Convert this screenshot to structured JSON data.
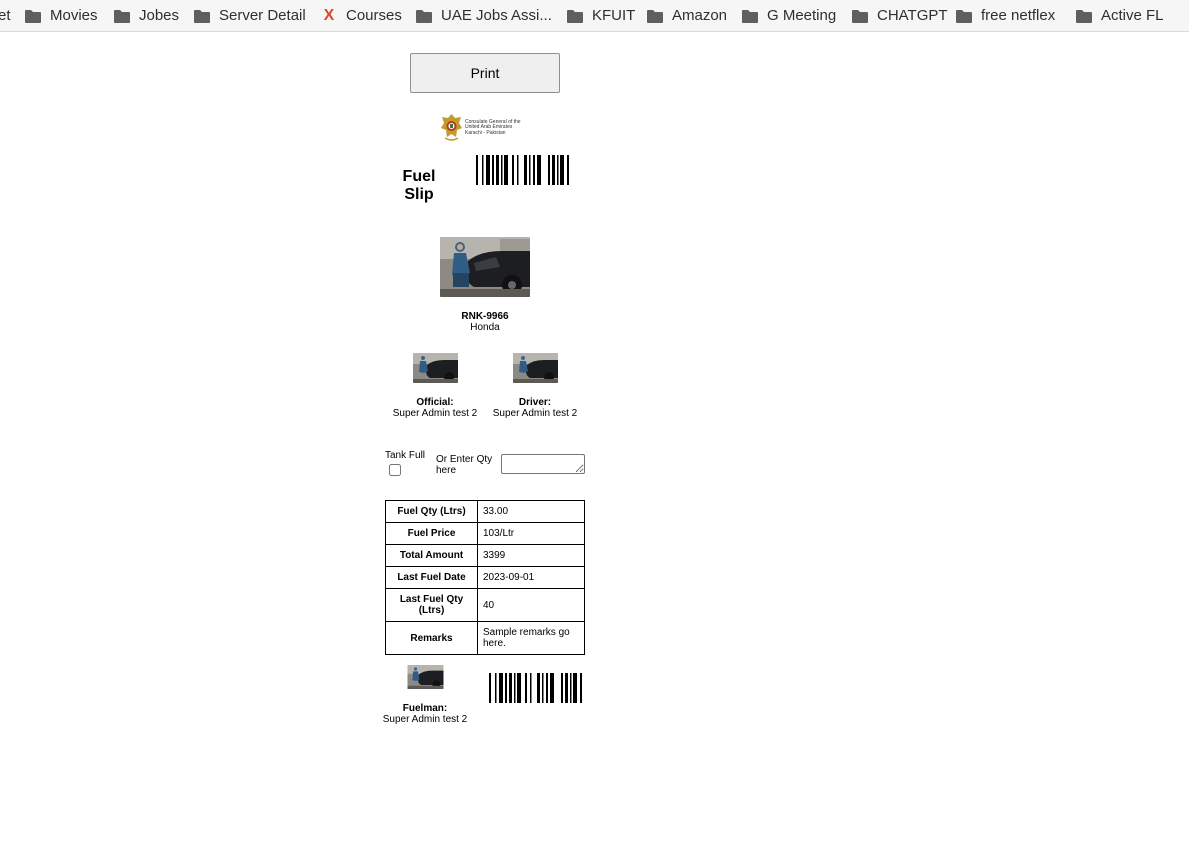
{
  "bookmarks": [
    {
      "label": "et",
      "icon": "none"
    },
    {
      "label": "Movies",
      "icon": "folder-icon"
    },
    {
      "label": "Jobes",
      "icon": "folder-icon"
    },
    {
      "label": "Server Detail",
      "icon": "folder-icon"
    },
    {
      "label": "Courses",
      "icon": "x-icon"
    },
    {
      "label": "UAE Jobs Assi...",
      "icon": "folder-icon"
    },
    {
      "label": "KFUIT",
      "icon": "folder-icon"
    },
    {
      "label": "Amazon",
      "icon": "folder-icon"
    },
    {
      "label": "G Meeting",
      "icon": "folder-icon"
    },
    {
      "label": "CHATGPT",
      "icon": "folder-icon"
    },
    {
      "label": "free netflex",
      "icon": "folder-icon"
    },
    {
      "label": "Active FL",
      "icon": "folder-icon"
    }
  ],
  "print_label": "Print",
  "logo": {
    "line1": "Consulate General of the",
    "line2": "United Arab Emirates",
    "line3": "Karachi - Pakistan"
  },
  "title": "Fuel Slip",
  "vehicle": {
    "plate": "RNK-9966",
    "make": "Honda"
  },
  "official": {
    "role": "Official:",
    "name": "Super Admin test 2"
  },
  "driver": {
    "role": "Driver:",
    "name": "Super Admin test 2"
  },
  "tank_full_label": "Tank Full",
  "qty_label": "Or Enter Qty here",
  "qty_value": "",
  "table": [
    {
      "key": "Fuel Qty (Ltrs)",
      "value": "33.00"
    },
    {
      "key": "Fuel Price",
      "value": "103/Ltr"
    },
    {
      "key": "Total Amount",
      "value": "3399"
    },
    {
      "key": "Last Fuel Date",
      "value": "2023-09-01"
    },
    {
      "key": "Last Fuel Qty (Ltrs)",
      "value": "40"
    },
    {
      "key": "Remarks",
      "value": "Sample remarks go here."
    }
  ],
  "fuelman": {
    "role": "Fuelman:",
    "name": "Super Admin test 2"
  },
  "colors": {
    "bookmark_bar": "#f6f6f6",
    "courses_icon": "#e0452c"
  }
}
